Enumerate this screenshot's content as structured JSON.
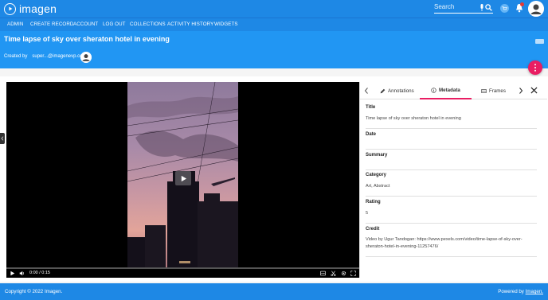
{
  "app": {
    "name": "imagen"
  },
  "search": {
    "placeholder": "Search"
  },
  "nav": {
    "items": [
      {
        "label": "ADMIN"
      },
      {
        "label": "CREATE RECORD"
      },
      {
        "label": "ACCOUNT"
      },
      {
        "label": "LOG OUT"
      },
      {
        "label": "COLLECTIONS"
      },
      {
        "label": "ACTIVITY HISTORY"
      },
      {
        "label": "WIDGETS"
      }
    ]
  },
  "header": {
    "title": "Time lapse of sky over sheraton hotel in evening",
    "created_by_label": "Created by",
    "created_by_user": "super...@imagenevp.com"
  },
  "player": {
    "time": "0:00 / 0:15",
    "progress": 0
  },
  "panel": {
    "tabs": [
      {
        "label": "Annotations",
        "icon": "pencil-icon"
      },
      {
        "label": "Metadata",
        "icon": "info-icon"
      },
      {
        "label": "Frames",
        "icon": "film-icon"
      }
    ],
    "active_tab": "Metadata",
    "fields": [
      {
        "label": "Title",
        "value": "Time lapse of sky over sheraton hotel in evening"
      },
      {
        "label": "Date",
        "value": ""
      },
      {
        "label": "Summary",
        "value": ""
      },
      {
        "label": "Category",
        "value": "Art, Abstract"
      },
      {
        "label": "Rating",
        "value": "5"
      },
      {
        "label": "Credit",
        "value": "Video by Ugur Tandogan: https://www.pexels.com/video/time-lapse-of-sky-over-sheraton-hotel-in-evening-11257476/"
      }
    ]
  },
  "footer": {
    "copyright": "Copyright © 2022 Imagen.",
    "powered_label": "Powered by",
    "powered_link": "Imagen."
  },
  "colors": {
    "primary": "#1e88e5",
    "header": "#2196f3",
    "accent": "#e91e63"
  }
}
